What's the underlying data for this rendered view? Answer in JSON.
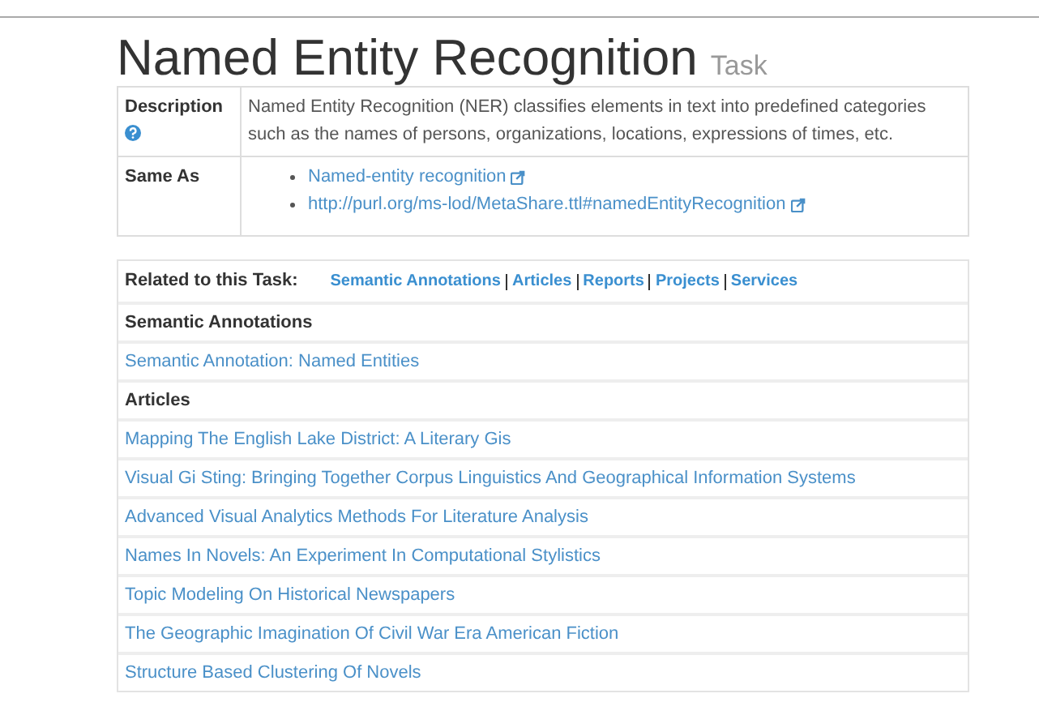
{
  "title": "Named Entity Recognition",
  "subtitle": "Task",
  "properties": [
    {
      "label": "Description",
      "help": true,
      "kind": "text",
      "text": "Named Entity Recognition (NER) classifies elements in text into predefined categories such as the names of persons, organizations, locations, expressions of times, etc."
    },
    {
      "label": "Same As",
      "help": false,
      "kind": "links",
      "links": [
        "Named-entity recognition",
        "http://purl.org/ms-lod/MetaShare.ttl#namedEntityRecognition"
      ]
    }
  ],
  "related": {
    "label": "Related to this Task:",
    "links": [
      "Semantic Annotations",
      "Articles",
      "Reports",
      "Projects",
      "Services"
    ]
  },
  "sections": [
    {
      "heading": "Semantic Annotations",
      "items": [
        "Semantic Annotation: Named Entities"
      ]
    },
    {
      "heading": "Articles",
      "items": [
        "Mapping The English Lake District: A Literary Gis",
        "Visual Gi Sting: Bringing Together Corpus Linguistics And Geographical Information Systems",
        "Advanced Visual Analytics Methods For Literature Analysis",
        "Names In Novels: An Experiment In Computational Stylistics",
        "Topic Modeling On Historical Newspapers",
        "The Geographic Imagination Of Civil War Era American Fiction",
        "Structure Based Clustering Of Novels"
      ]
    }
  ]
}
